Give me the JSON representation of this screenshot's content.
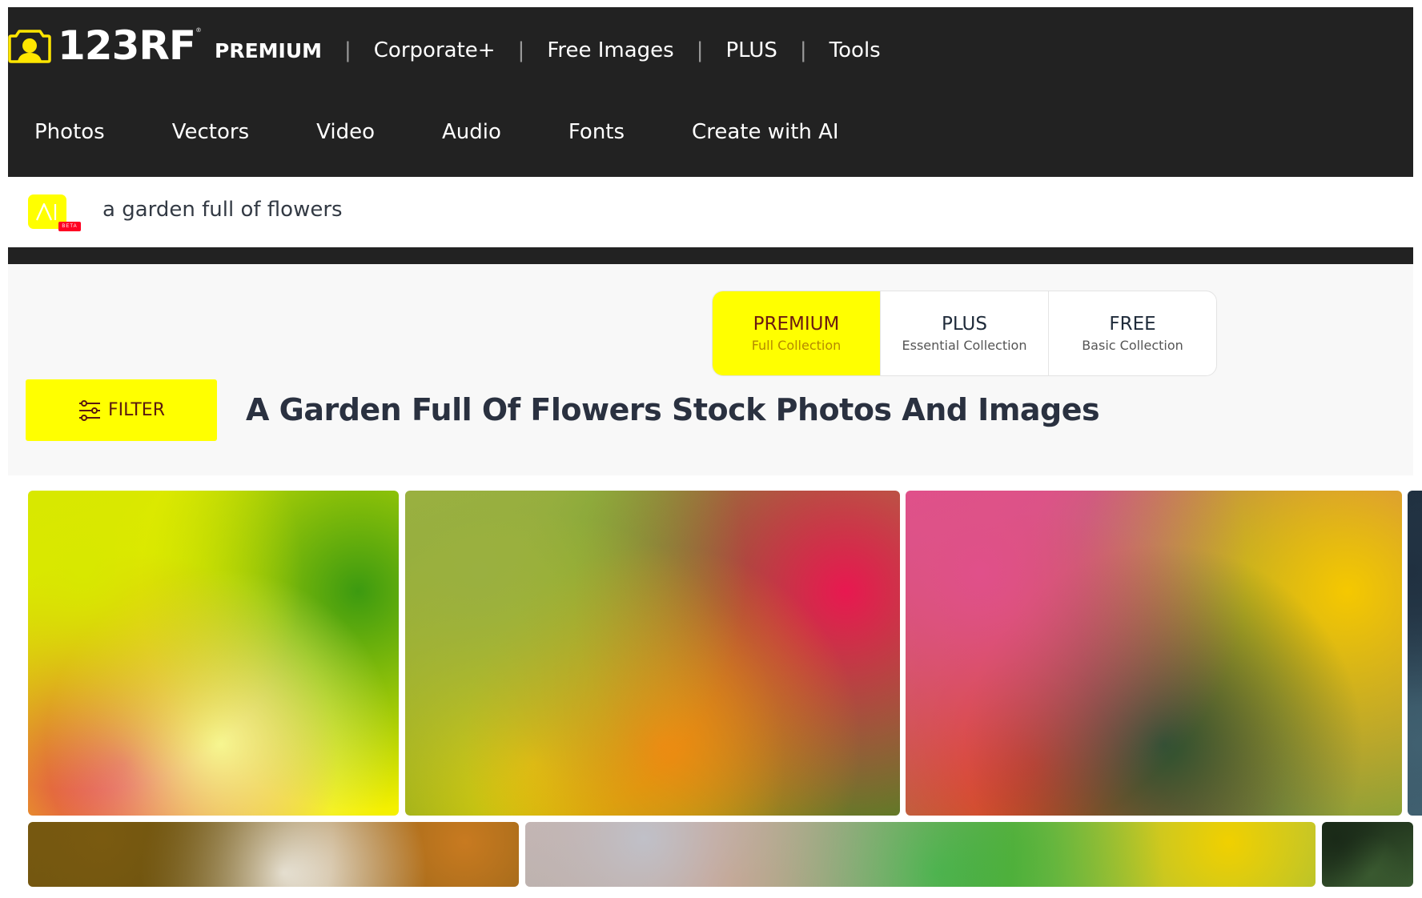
{
  "brand": {
    "name": "123RF",
    "registered_mark": "®",
    "accent_color": "#ffff00",
    "header_bg": "#222222"
  },
  "topnav": {
    "items": [
      {
        "label": "PREMIUM",
        "bold": true
      },
      {
        "label": "Corporate+"
      },
      {
        "label": "Free Images"
      },
      {
        "label": "PLUS"
      },
      {
        "label": "Tools"
      }
    ],
    "separator": "|"
  },
  "subnav": {
    "items": [
      {
        "label": "Photos"
      },
      {
        "label": "Vectors"
      },
      {
        "label": "Video"
      },
      {
        "label": "Audio"
      },
      {
        "label": "Fonts"
      },
      {
        "label": "Create with AI"
      }
    ]
  },
  "search": {
    "ai_badge_label": "AI",
    "beta_label": "BETA",
    "query": "a garden full of flowers"
  },
  "collections": {
    "items": [
      {
        "title": "PREMIUM",
        "subtitle": "Full Collection",
        "active": true
      },
      {
        "title": "PLUS",
        "subtitle": "Essential Collection",
        "active": false
      },
      {
        "title": "FREE",
        "subtitle": "Basic Collection",
        "active": false
      }
    ]
  },
  "filter": {
    "label": "FILTER",
    "icon": "sliders-icon"
  },
  "page": {
    "title": "A Garden Full Of Flowers Stock Photos And Images"
  },
  "results": {
    "rows": [
      [
        {
          "alt": "sunlit garden with pink and red flowers",
          "palette": [
            "#d8e800",
            "#f6f690",
            "#3c9a10",
            "#e02060",
            "#f5f000"
          ]
        },
        {
          "alt": "flower bed of orange, yellow and pink blossoms",
          "palette": [
            "#9ab040",
            "#f08a10",
            "#e81850",
            "#f5d800",
            "#4a8a20"
          ]
        },
        {
          "alt": "field of yellow marigolds with pink trees",
          "palette": [
            "#e0508a",
            "#2a5030",
            "#f5c800",
            "#e83810",
            "#7a9a40"
          ]
        },
        {
          "alt": "partial image",
          "palette": [
            "#203040",
            "#406070"
          ]
        }
      ],
      [
        {
          "alt": "sun flare through autumn foliage",
          "palette": [
            "#7a5a10",
            "#ffffff",
            "#c87a20",
            "#5a4a10"
          ]
        },
        {
          "alt": "green leaves with yellow orange flowers",
          "palette": [
            "#c0c0c8",
            "#30b030",
            "#f0d000",
            "#e06010",
            "#20a0a0"
          ]
        },
        {
          "alt": "dark green bokeh",
          "palette": [
            "#1a2a18",
            "#3a5a30"
          ]
        }
      ]
    ]
  }
}
